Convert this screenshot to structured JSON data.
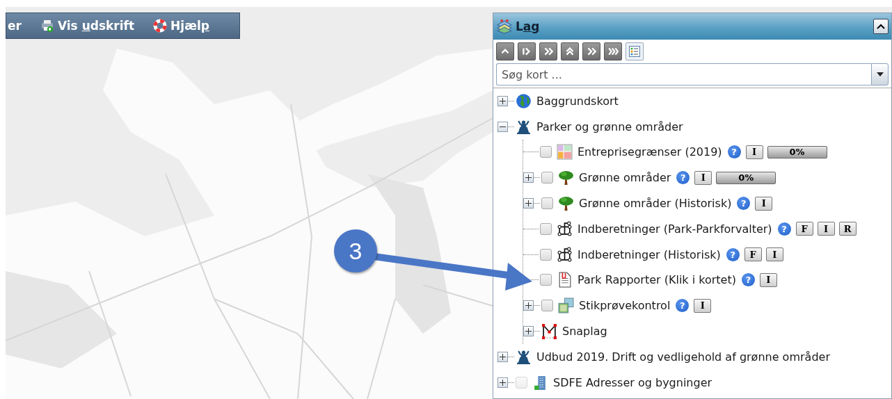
{
  "toolbar": {
    "items": [
      {
        "kind": "plain",
        "parts": [
          "er"
        ]
      },
      {
        "kind": "print",
        "parts": [
          "Vis ",
          "u",
          "dskrift"
        ]
      },
      {
        "kind": "help",
        "parts": [
          "Hjæl",
          "p"
        ]
      }
    ]
  },
  "panel": {
    "title_parts": [
      "L",
      "ag"
    ],
    "collapsed": false,
    "search": {
      "placeholder": "Søg kort ..."
    },
    "tree": [
      {
        "label": "Baggrundskort",
        "kind": "globe",
        "expanded": false
      },
      {
        "label": "Parker og grønne områder",
        "kind": "statue",
        "expanded": true,
        "children": [
          {
            "label": "Entreprisegrænser (2019)",
            "kind": "grid",
            "checked": false,
            "disabled": false,
            "help": "?",
            "buttons": [
              "I"
            ],
            "progress": {
              "level": 0,
              "reading": "0%"
            }
          },
          {
            "label": "Grønne områder",
            "kind": "tree",
            "expanded": false,
            "checked": false,
            "disabled": false,
            "help": "?",
            "buttons": [
              "I"
            ],
            "progress": {
              "level": 0,
              "reading": "0%"
            }
          },
          {
            "label": "Grønne områder (Historisk)",
            "kind": "tree",
            "expanded": false,
            "checked": false,
            "disabled": false,
            "help": "?",
            "buttons": [
              "I"
            ]
          },
          {
            "label": "Indberetninger (Park-Parkforvalter)",
            "kind": "network",
            "checked": false,
            "disabled": false,
            "help": "?",
            "buttons": [
              "F",
              "I",
              "R"
            ]
          },
          {
            "label": "Indberetninger (Historisk)",
            "kind": "network",
            "checked": false,
            "disabled": false,
            "help": "?",
            "buttons": [
              "F",
              "I"
            ]
          },
          {
            "label": "Park Rapporter (Klik i kortet)",
            "kind": "document",
            "checked": false,
            "disabled": false,
            "help": "?",
            "buttons": [
              "I"
            ]
          },
          {
            "label": "Stikprøvekontrol",
            "kind": "images",
            "expanded": false,
            "checked": false,
            "disabled": false,
            "help": "?",
            "buttons": [
              "I"
            ]
          },
          {
            "label": "Snaplag",
            "kind": "snap",
            "expanded": false
          }
        ]
      },
      {
        "label": "Udbud 2019. Drift og vedligehold af grønne områder",
        "kind": "statue",
        "expanded": false
      },
      {
        "label": "SDFE Adresser og bygninger",
        "kind": "building",
        "expanded": false,
        "checked": false,
        "disabled": true
      }
    ]
  },
  "callout": {
    "label": "3"
  }
}
